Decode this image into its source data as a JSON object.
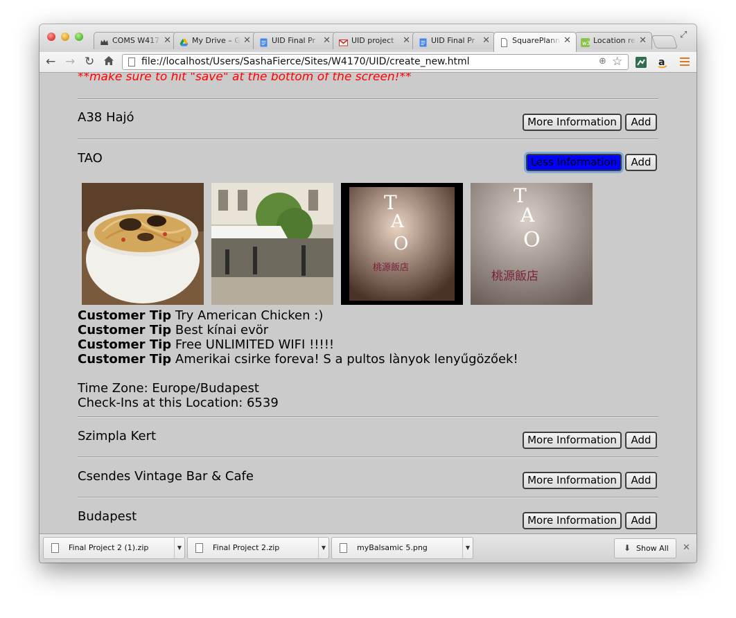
{
  "tabs": [
    {
      "title": "COMS W417",
      "icon": "columbia-crown-icon"
    },
    {
      "title": "My Drive – G",
      "icon": "google-drive-icon"
    },
    {
      "title": "UID Final Pr",
      "icon": "google-docs-icon"
    },
    {
      "title": "UID project",
      "icon": "gmail-icon"
    },
    {
      "title": "UID Final Pr",
      "icon": "google-docs-icon"
    },
    {
      "title": "SquarePlann",
      "icon": "page-icon"
    },
    {
      "title": "Location rel",
      "icon": "w3schools-icon"
    }
  ],
  "active_tab": 5,
  "toolbar": {
    "url": "file://localhost/Users/SashaFierce/Sites/W4170/UID/create_new.html"
  },
  "page": {
    "notice": "**make sure to hit \"save\" at the bottom of the screen!**",
    "more_label": "More Information",
    "less_label": "Less Information",
    "add_label": "Add",
    "locations": [
      {
        "name": "A38 Hajó"
      },
      {
        "name": "TAO"
      },
      {
        "name": "Szimpla Kert"
      },
      {
        "name": "Csendes Vintage Bar & Cafe"
      },
      {
        "name": "Budapest"
      }
    ],
    "tao": {
      "tip_label": "Customer Tip",
      "tips": [
        "Try American Chicken :)",
        "Best kínai evör",
        "Free UNLIMITED WIFI !!!!!",
        "Amerikai csirke foreva! S a pultos lànyok lenyűgözőek!"
      ],
      "time_zone": "Time Zone: Europe/Budapest",
      "checkins": "Check-Ins at this Location: 6539",
      "sign_chinese": "桃源飯店"
    }
  },
  "downloads": {
    "items": [
      "Final Project 2 (1).zip",
      "Final Project 2.zip",
      "myBalsamic 5.png"
    ],
    "show_all": "Show All"
  }
}
